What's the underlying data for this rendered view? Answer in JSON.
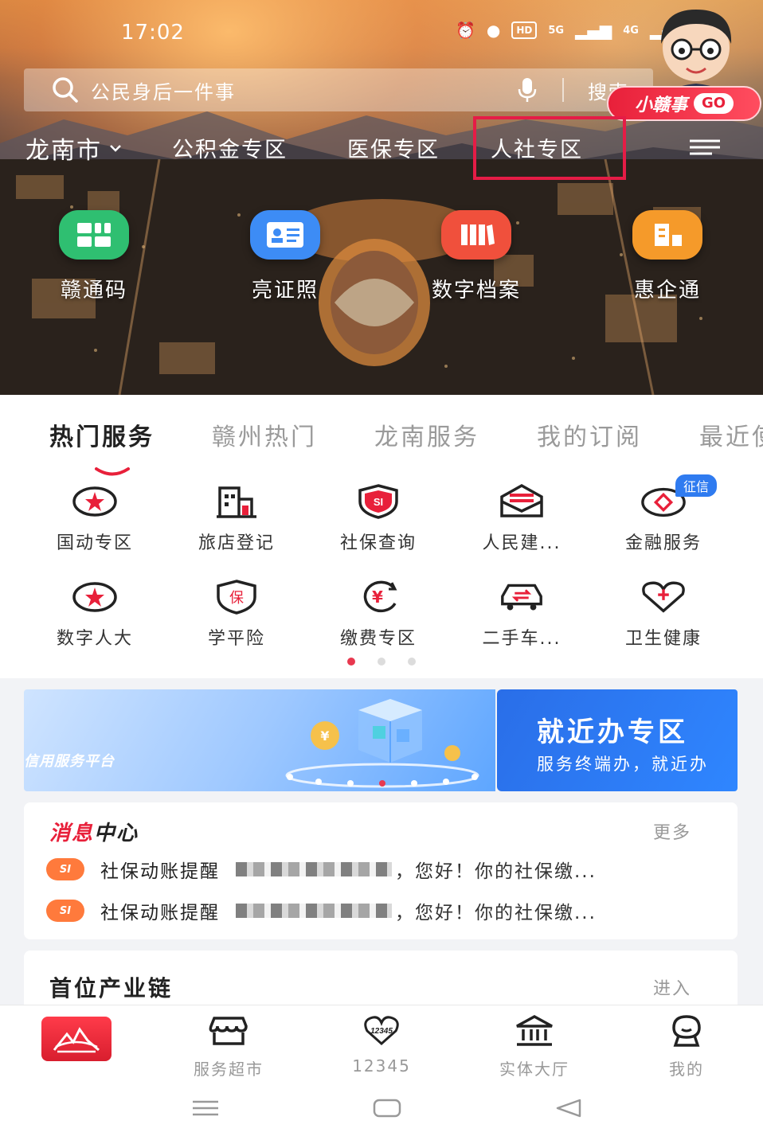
{
  "status_bar": {
    "time": "17:02",
    "network_badge": "HD",
    "signal_5g": "5G",
    "signal_4g": "4G"
  },
  "search": {
    "placeholder": "公民身后一件事",
    "button_label": "搜索"
  },
  "mascot": {
    "badge_text": "小赣事",
    "go_label": "GO"
  },
  "region_bar": {
    "city": "龙南市",
    "zones": [
      "公积金专区",
      "医保专区",
      "人社专区"
    ]
  },
  "quick_access": [
    {
      "label": "赣通码",
      "icon": "qr-grid-icon",
      "color": "#2fbf71"
    },
    {
      "label": "亮证照",
      "icon": "id-card-icon",
      "color": "#3d8cf5"
    },
    {
      "label": "数字档案",
      "icon": "archive-books-icon",
      "color": "#f0503c"
    },
    {
      "label": "惠企通",
      "icon": "enterprise-icon",
      "color": "#f59a2a"
    }
  ],
  "service_tabs": [
    "热门服务",
    "赣州热门",
    "龙南服务",
    "我的订阅",
    "最近使用"
  ],
  "services": [
    {
      "label": "国动专区",
      "icon": "star-badge-icon"
    },
    {
      "label": "旅店登记",
      "icon": "building-icon"
    },
    {
      "label": "社保查询",
      "icon": "social-security-icon"
    },
    {
      "label": "人民建...",
      "icon": "mail-icon"
    },
    {
      "label": "金融服务",
      "icon": "finance-icon"
    },
    {
      "label": "数字人大",
      "icon": "star-badge-icon"
    },
    {
      "label": "学平险",
      "icon": "insurance-shield-icon"
    },
    {
      "label": "缴费专区",
      "icon": "yuan-payment-icon"
    },
    {
      "label": "二手车...",
      "icon": "car-icon"
    },
    {
      "label": "卫生健康",
      "icon": "heart-plus-icon"
    }
  ],
  "credit_badge": "征信",
  "banner": {
    "left_text": "信用服务平台",
    "title": "就近办专区",
    "subtitle": "服务终端办，就近办"
  },
  "message_center": {
    "title_red": "消息",
    "title_black": "中心",
    "more_label": "更多",
    "messages": [
      {
        "type": "社保动账提醒",
        "body": "，您好！你的社保缴..."
      },
      {
        "type": "社保动账提醒",
        "body": "，您好！你的社保缴..."
      }
    ]
  },
  "industry_chain": {
    "title": "首位产业链",
    "enter_label": "进入"
  },
  "bottom_nav": [
    {
      "label": "服务超市",
      "icon": "store-icon"
    },
    {
      "label": "12345",
      "icon": "hotline-12345-icon"
    },
    {
      "label": "实体大厅",
      "icon": "bank-hall-icon"
    },
    {
      "label": "我的",
      "icon": "profile-icon"
    }
  ],
  "colors": {
    "accent_red": "#e8203a",
    "primary_blue": "#2f7bf0",
    "highlight_box": "#e51c46"
  }
}
